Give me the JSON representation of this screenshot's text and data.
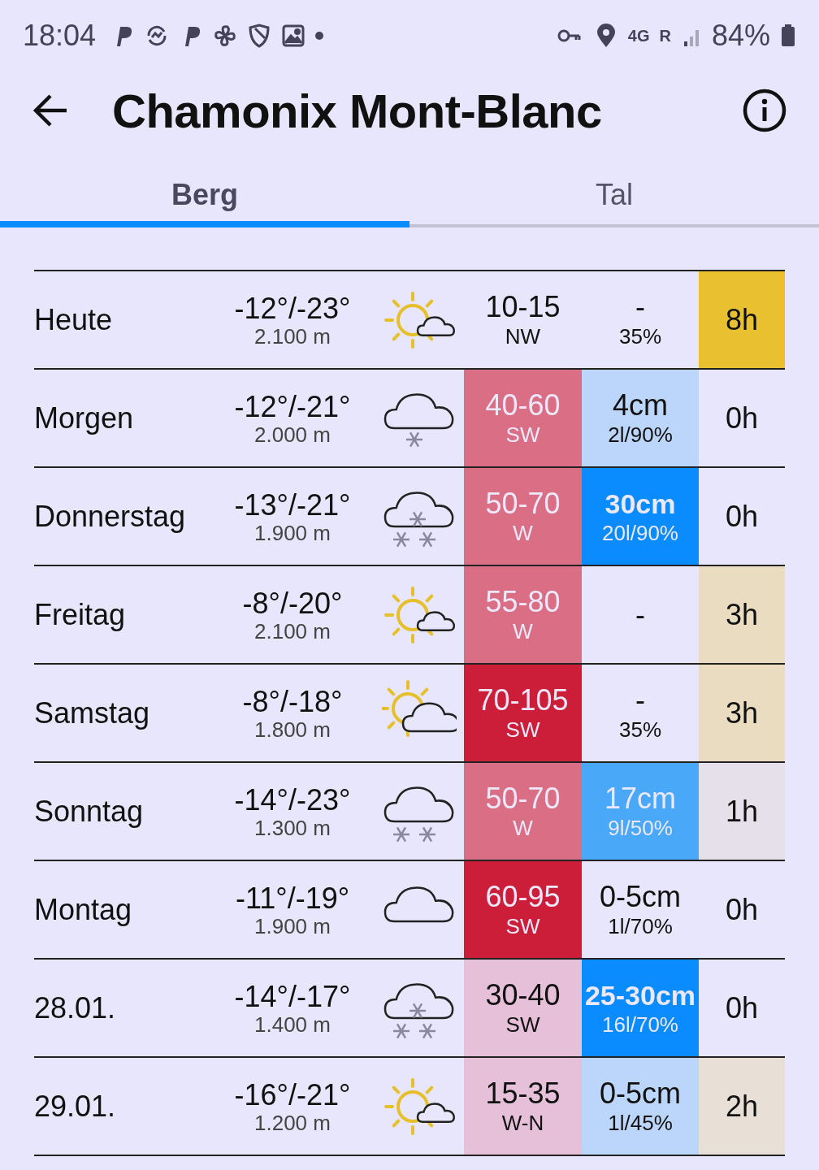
{
  "status_bar": {
    "time": "18:04",
    "network": "4G",
    "roaming": "R",
    "battery": "84%"
  },
  "header": {
    "title": "Chamonix Mont-Blanc"
  },
  "tabs": [
    {
      "label": "Berg",
      "selected": true
    },
    {
      "label": "Tal",
      "selected": false
    }
  ],
  "rows": [
    {
      "day": "Heute",
      "temp": "-12°/-23°",
      "altitude": "2.100 m",
      "kind": "partly-sunny",
      "wind": {
        "speed": "10-15",
        "dir": "NW"
      },
      "snow": {
        "amount": "-",
        "detail": "35%",
        "bold": false
      },
      "sun": {
        "hours": "8h",
        "color": "#e8c030"
      }
    },
    {
      "day": "Morgen",
      "temp": "-12°/-21°",
      "altitude": "2.000 m",
      "kind": "light-snow",
      "wind": {
        "speed": "40-60",
        "dir": "SW",
        "color": "#d96e84"
      },
      "snow": {
        "amount": "4cm",
        "detail": "2l/90%",
        "bold": false,
        "color": "#bcd6fb"
      },
      "sun": {
        "hours": "0h"
      }
    },
    {
      "day": "Donnerstag",
      "temp": "-13°/-21°",
      "altitude": "1.900 m",
      "kind": "heavy-snow",
      "wind": {
        "speed": "50-70",
        "dir": "W",
        "color": "#d96e84"
      },
      "snow": {
        "amount": "30cm",
        "detail": "20l/90%",
        "bold": true,
        "color": "#0a8cff"
      },
      "sun": {
        "hours": "0h"
      }
    },
    {
      "day": "Freitag",
      "temp": "-8°/-20°",
      "altitude": "2.100 m",
      "kind": "partly-sunny",
      "wind": {
        "speed": "55-80",
        "dir": "W",
        "color": "#d96e84"
      },
      "snow": {
        "amount": "-",
        "bold": false
      },
      "sun": {
        "hours": "3h",
        "color": "#eadcc0"
      }
    },
    {
      "day": "Samstag",
      "temp": "-8°/-18°",
      "altitude": "1.800 m",
      "kind": "mostly-cloudy",
      "wind": {
        "speed": "70-105",
        "dir": "SW",
        "color": "#cc1e38"
      },
      "snow": {
        "amount": "-",
        "detail": "35%",
        "bold": false
      },
      "sun": {
        "hours": "3h",
        "color": "#eadcc0"
      }
    },
    {
      "day": "Sonntag",
      "temp": "-14°/-23°",
      "altitude": "1.300 m",
      "kind": "snow",
      "wind": {
        "speed": "50-70",
        "dir": "W",
        "color": "#d96e84"
      },
      "snow": {
        "amount": "17cm",
        "detail": "9l/50%",
        "bold": false,
        "color": "#4aa8f8"
      },
      "sun": {
        "hours": "1h",
        "color": "#e6e0ea"
      }
    },
    {
      "day": "Montag",
      "temp": "-11°/-19°",
      "altitude": "1.900 m",
      "kind": "cloudy",
      "wind": {
        "speed": "60-95",
        "dir": "SW",
        "color": "#cc1e38"
      },
      "snow": {
        "amount": "0-5cm",
        "detail": "1l/70%",
        "bold": false
      },
      "sun": {
        "hours": "0h"
      }
    },
    {
      "day": "28.01.",
      "temp": "-14°/-17°",
      "altitude": "1.400 m",
      "kind": "heavy-snow",
      "wind": {
        "speed": "30-40",
        "dir": "SW",
        "color": "#e6c0d8"
      },
      "snow": {
        "amount": "25-30cm",
        "detail": "16l/70%",
        "bold": true,
        "color": "#0a8cff"
      },
      "sun": {
        "hours": "0h"
      }
    },
    {
      "day": "29.01.",
      "temp": "-16°/-21°",
      "altitude": "1.200 m",
      "kind": "partly-sunny",
      "wind": {
        "speed": "15-35",
        "dir": "W-N",
        "color": "#e6c0d8"
      },
      "snow": {
        "amount": "0-5cm",
        "detail": "1l/45%",
        "bold": false,
        "color": "#bcd6fb"
      },
      "sun": {
        "hours": "2h",
        "color": "#e8e0d6"
      }
    }
  ]
}
